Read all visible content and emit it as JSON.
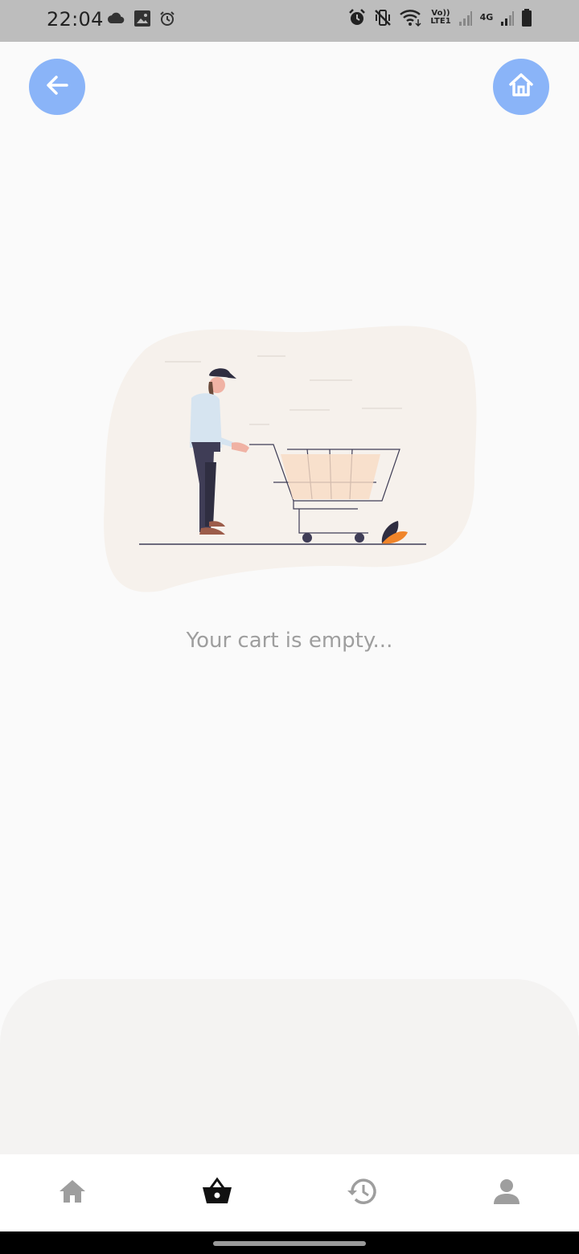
{
  "status_bar": {
    "time": "22:04",
    "volte_label": "Vo)) LTE1",
    "network_label": "4G",
    "left_icons": [
      "cloud-icon",
      "image-icon",
      "alarm-icon"
    ],
    "right_icons": [
      "alarm-icon",
      "vibrate-mute-icon",
      "wifi-icon",
      "signal-icon",
      "battery-icon"
    ]
  },
  "header": {
    "back_icon": "arrow-left-icon",
    "home_icon": "home-icon",
    "fab_color": "#8ab4f8"
  },
  "main": {
    "empty_message": "Your cart is empty..."
  },
  "bottom_nav": {
    "items": [
      {
        "icon": "home-icon",
        "active": false
      },
      {
        "icon": "basket-icon",
        "active": true
      },
      {
        "icon": "history-icon",
        "active": false
      },
      {
        "icon": "profile-icon",
        "active": false
      }
    ],
    "active_color": "#111111",
    "inactive_color": "#9e9e9e"
  }
}
